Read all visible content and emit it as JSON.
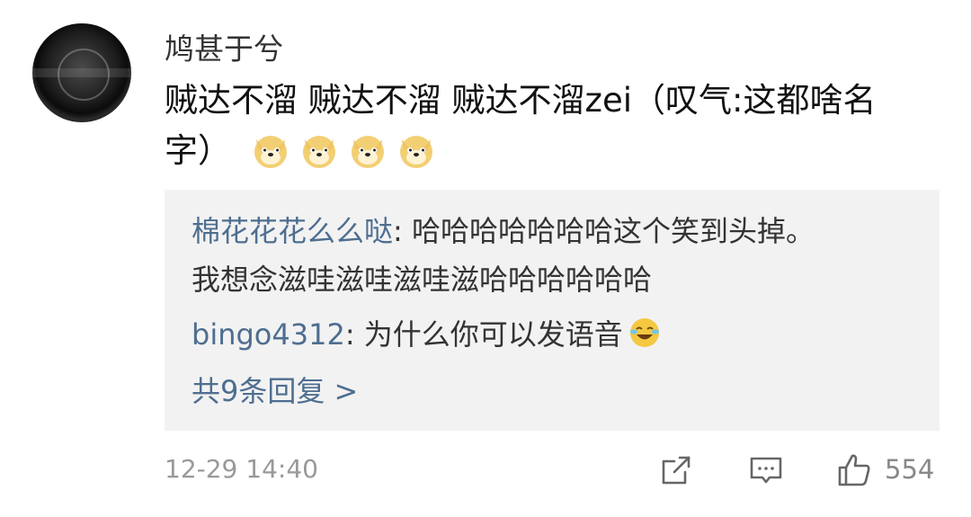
{
  "comment": {
    "username": "鸠甚于兮",
    "text": "贼达不溜 贼达不溜 贼达不溜zei（叹气:这都啥名字）",
    "emoji": "doge-icon",
    "emoji_count": 4,
    "timestamp": "12-29 14:40",
    "like_count": "554"
  },
  "replies": [
    {
      "author": "棉花花花么么哒",
      "separator": ":",
      "text_line1": " 哈哈哈哈哈哈哈这个笑到头掉。",
      "text_line2": "我想念滋哇滋哇滋哇滋哈哈哈哈哈哈"
    },
    {
      "author": "bingo4312",
      "separator": ":",
      "text": " 为什么你可以发语音",
      "emoji": "laugh-cry-icon"
    }
  ],
  "more_replies": "共9条回复 >",
  "colors": {
    "link": "#4e6e90",
    "reply_bg": "#f2f2f2",
    "meta": "#999999"
  }
}
